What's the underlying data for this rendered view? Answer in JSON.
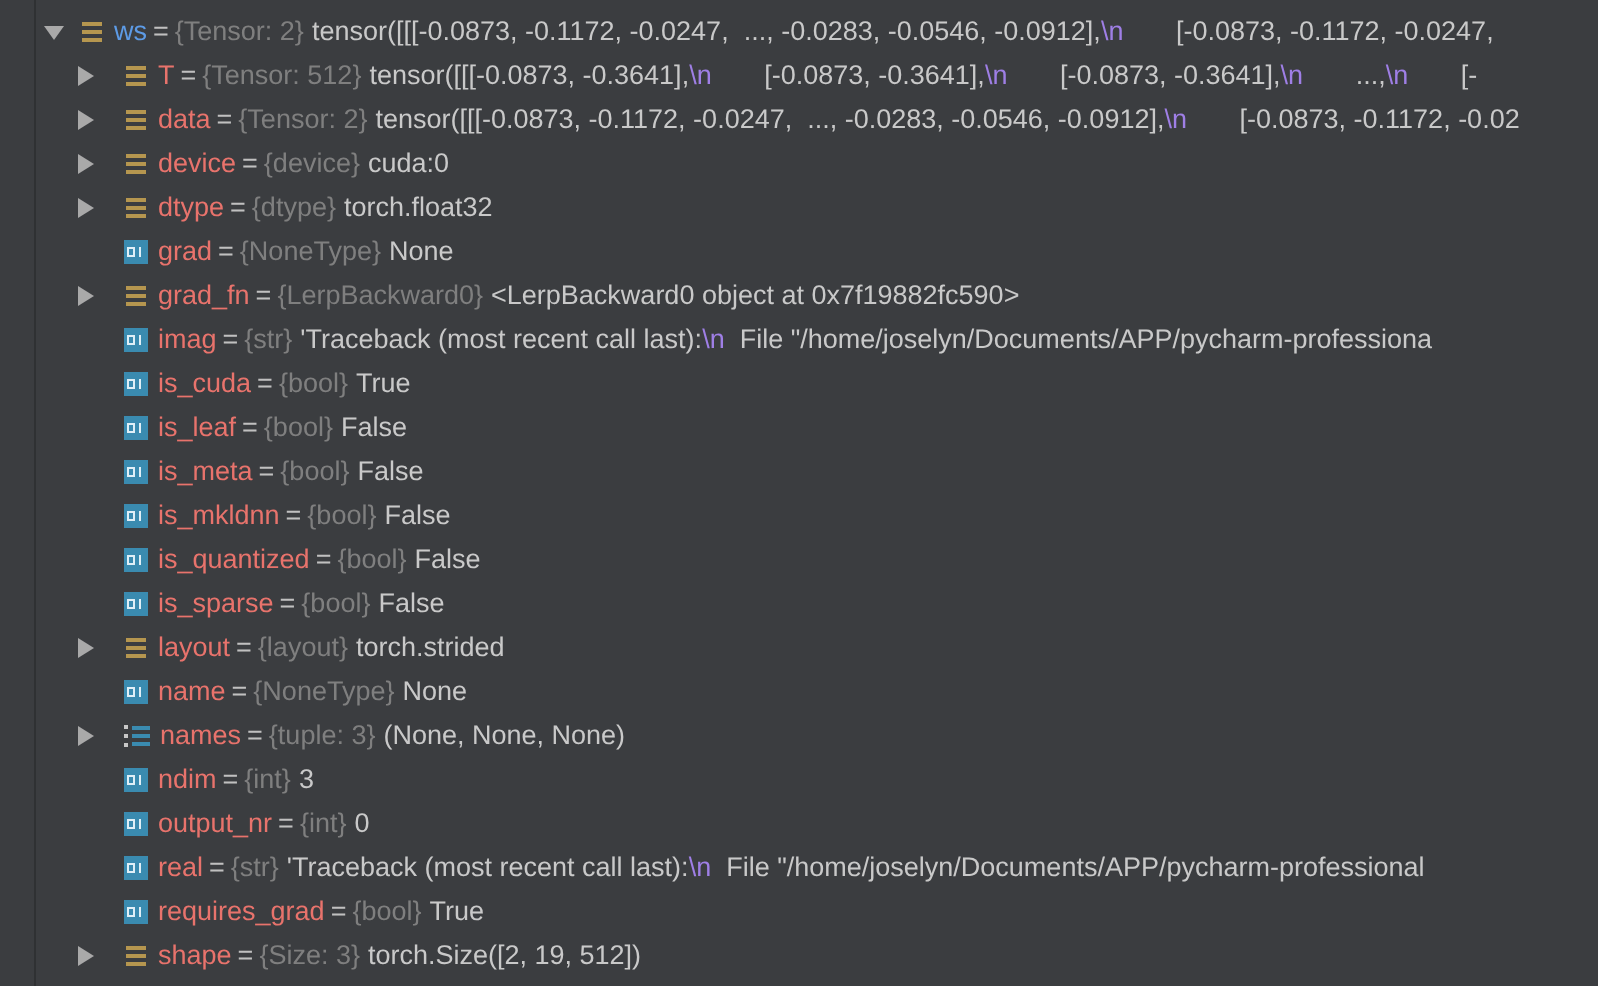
{
  "variables": [
    {
      "name": "ws",
      "sep": "=",
      "type": "{Tensor: 2}",
      "kind": "stack",
      "expanded": true,
      "value": [
        {
          "kind": "plain",
          "text": "tensor([[[-0.0873, -0.1172, -0.0247,  ..., -0.0283, -0.0546, -0.0912],"
        },
        {
          "kind": "escape",
          "text": "\\n"
        },
        {
          "kind": "plain",
          "text": "       [-0.0873, -0.1172, -0.0247,"
        }
      ],
      "children": [
        {
          "name": "T",
          "sep": "=",
          "type": "{Tensor: 512}",
          "kind": "stack",
          "expanded": false,
          "value": [
            {
              "kind": "plain",
              "text": "tensor([[[-0.0873, -0.3641],"
            },
            {
              "kind": "escape",
              "text": "\\n"
            },
            {
              "kind": "plain",
              "text": "       [-0.0873, -0.3641],"
            },
            {
              "kind": "escape",
              "text": "\\n"
            },
            {
              "kind": "plain",
              "text": "       [-0.0873, -0.3641],"
            },
            {
              "kind": "escape",
              "text": "\\n"
            },
            {
              "kind": "plain",
              "text": "       ...,"
            },
            {
              "kind": "escape",
              "text": "\\n"
            },
            {
              "kind": "plain",
              "text": "       [-"
            }
          ]
        },
        {
          "name": "data",
          "sep": "=",
          "type": "{Tensor: 2}",
          "kind": "stack",
          "expanded": false,
          "value": [
            {
              "kind": "plain",
              "text": "tensor([[[-0.0873, -0.1172, -0.0247,  ..., -0.0283, -0.0546, -0.0912],"
            },
            {
              "kind": "escape",
              "text": "\\n"
            },
            {
              "kind": "plain",
              "text": "       [-0.0873, -0.1172, -0.02"
            }
          ]
        },
        {
          "name": "device",
          "sep": "=",
          "type": "{device}",
          "kind": "stack",
          "expanded": false,
          "value": [
            {
              "kind": "plain",
              "text": "cuda:0"
            }
          ]
        },
        {
          "name": "dtype",
          "sep": "=",
          "type": "{dtype}",
          "kind": "stack",
          "expanded": false,
          "value": [
            {
              "kind": "plain",
              "text": "torch.float32"
            }
          ]
        },
        {
          "name": "grad",
          "sep": "=",
          "type": "{NoneType}",
          "kind": "value",
          "value": [
            {
              "kind": "plain",
              "text": "None"
            }
          ]
        },
        {
          "name": "grad_fn",
          "sep": "=",
          "type": "{LerpBackward0}",
          "kind": "stack",
          "expanded": false,
          "value": [
            {
              "kind": "plain",
              "text": "<LerpBackward0 object at 0x7f19882fc590>"
            }
          ]
        },
        {
          "name": "imag",
          "sep": "=",
          "type": "{str}",
          "kind": "value",
          "value": [
            {
              "kind": "plain",
              "text": "'Traceback (most recent call last):"
            },
            {
              "kind": "escape",
              "text": "\\n"
            },
            {
              "kind": "plain",
              "text": "  File \"/home/joselyn/Documents/APP/pycharm-professiona"
            }
          ]
        },
        {
          "name": "is_cuda",
          "sep": "=",
          "type": "{bool}",
          "kind": "value",
          "value": [
            {
              "kind": "plain",
              "text": "True"
            }
          ]
        },
        {
          "name": "is_leaf",
          "sep": "=",
          "type": "{bool}",
          "kind": "value",
          "value": [
            {
              "kind": "plain",
              "text": "False"
            }
          ]
        },
        {
          "name": "is_meta",
          "sep": "=",
          "type": "{bool}",
          "kind": "value",
          "value": [
            {
              "kind": "plain",
              "text": "False"
            }
          ]
        },
        {
          "name": "is_mkldnn",
          "sep": "=",
          "type": "{bool}",
          "kind": "value",
          "value": [
            {
              "kind": "plain",
              "text": "False"
            }
          ]
        },
        {
          "name": "is_quantized",
          "sep": "=",
          "type": "{bool}",
          "kind": "value",
          "value": [
            {
              "kind": "plain",
              "text": "False"
            }
          ]
        },
        {
          "name": "is_sparse",
          "sep": "=",
          "type": "{bool}",
          "kind": "value",
          "value": [
            {
              "kind": "plain",
              "text": "False"
            }
          ]
        },
        {
          "name": "layout",
          "sep": "=",
          "type": "{layout}",
          "kind": "stack",
          "expanded": false,
          "value": [
            {
              "kind": "plain",
              "text": "torch.strided"
            }
          ]
        },
        {
          "name": "name",
          "sep": "=",
          "type": "{NoneType}",
          "kind": "value",
          "value": [
            {
              "kind": "plain",
              "text": "None"
            }
          ]
        },
        {
          "name": "names",
          "sep": "=",
          "type": "{tuple: 3}",
          "kind": "list",
          "expanded": false,
          "value": [
            {
              "kind": "plain",
              "text": "(None, None, None)"
            }
          ]
        },
        {
          "name": "ndim",
          "sep": "=",
          "type": "{int}",
          "kind": "value",
          "value": [
            {
              "kind": "plain",
              "text": "3"
            }
          ]
        },
        {
          "name": "output_nr",
          "sep": "=",
          "type": "{int}",
          "kind": "value",
          "value": [
            {
              "kind": "plain",
              "text": "0"
            }
          ]
        },
        {
          "name": "real",
          "sep": "=",
          "type": "{str}",
          "kind": "value",
          "value": [
            {
              "kind": "plain",
              "text": "'Traceback (most recent call last):"
            },
            {
              "kind": "escape",
              "text": "\\n"
            },
            {
              "kind": "plain",
              "text": "  File \"/home/joselyn/Documents/APP/pycharm-professional"
            }
          ]
        },
        {
          "name": "requires_grad",
          "sep": "=",
          "type": "{bool}",
          "kind": "value",
          "value": [
            {
              "kind": "plain",
              "text": "True"
            }
          ]
        },
        {
          "name": "shape",
          "sep": "=",
          "type": "{Size: 3}",
          "kind": "stack",
          "expanded": false,
          "value": [
            {
              "kind": "plain",
              "text": "torch.Size([2, 19, 512])"
            }
          ]
        }
      ]
    }
  ]
}
